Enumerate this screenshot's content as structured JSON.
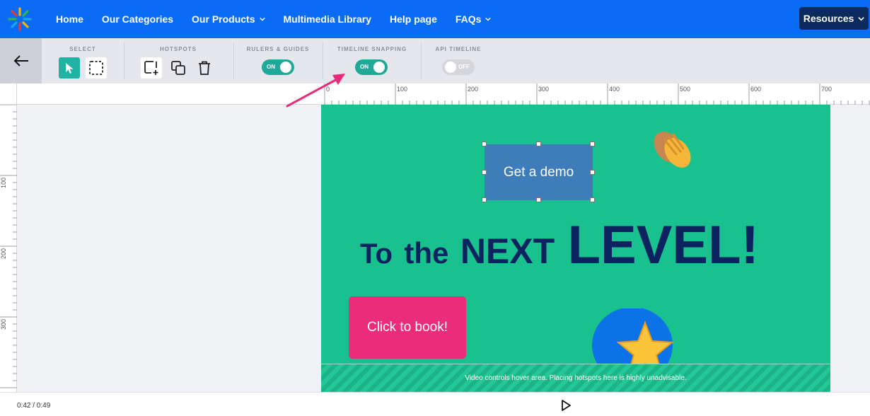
{
  "nav": {
    "items": [
      {
        "label": "Home",
        "has_dropdown": false
      },
      {
        "label": "Our Categories",
        "has_dropdown": false
      },
      {
        "label": "Our Products",
        "has_dropdown": true
      },
      {
        "label": "Multimedia Library",
        "has_dropdown": false
      },
      {
        "label": "Help page",
        "has_dropdown": false
      },
      {
        "label": "FAQs",
        "has_dropdown": true
      }
    ],
    "resources_label": "Resources",
    "color": "#0a6cf5"
  },
  "toolbar": {
    "select_label": "SELECT",
    "hotspots_label": "HOTSPOTS",
    "rulers_label": "RULERS & GUIDES",
    "rulers_state": "ON",
    "snapping_label": "TIMELINE SNAPPING",
    "snapping_state": "ON",
    "api_label": "API TIMELINE",
    "api_state": "OFF"
  },
  "ruler": {
    "top_ticks": [
      "0",
      "100",
      "200",
      "300",
      "400",
      "500",
      "600",
      "700"
    ],
    "left_ticks": [
      "100",
      "200",
      "300"
    ]
  },
  "stage": {
    "demo_button": "Get a demo",
    "headline": {
      "w1": "To",
      "w2": "the",
      "w3": "NEXT",
      "w4": "LEVEL!"
    },
    "book_button": "Click to book!",
    "hover_note": "Video controls hover area. Placing hotspots here is highly unadvisable.",
    "background": "#18c18d",
    "book_color": "#ea2c7b",
    "demo_color": "#3e7db9"
  },
  "player": {
    "time": "0:42 / 0:49"
  }
}
